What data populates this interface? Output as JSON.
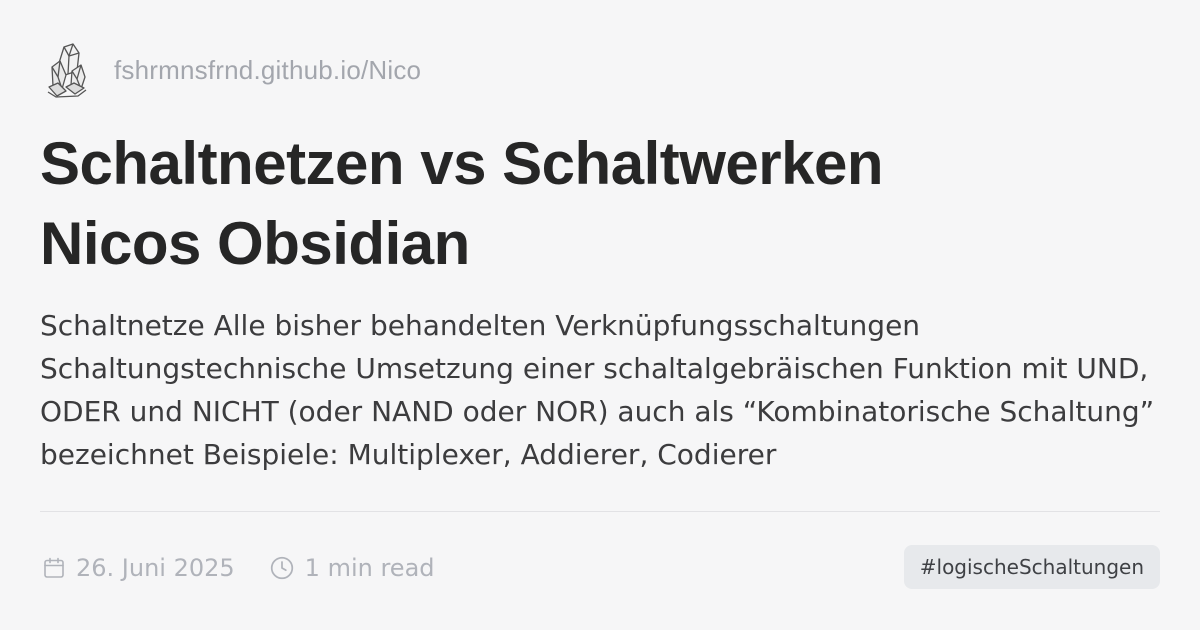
{
  "site": {
    "logo_icon": "crystal-icon",
    "name": "fshrmnsfrnd.github.io/Nico"
  },
  "post": {
    "title_line1": "Schaltnetzen vs Schaltwerken",
    "title_line2": "Nicos Obsidian",
    "excerpt": "Schaltnetze Alle bisher behandelten Verknüpfungsschaltungen Schaltungstechnische Umsetzung einer schaltalgebräischen Funktion mit UND, ODER und NICHT (oder NAND oder NOR) auch als “Kombinatorische Schaltung” bezeichnet Beispiele: Multiplexer, Addierer, Codierer"
  },
  "meta": {
    "date_icon": "calendar-icon",
    "date": "26. Juni 2025",
    "reading_icon": "clock-icon",
    "reading_time": "1 min read"
  },
  "tags": [
    "#logischeSchaltungen"
  ],
  "colors": {
    "background": "#f6f6f7",
    "title": "#262626",
    "muted": "#a3a6ad",
    "tag_background": "#e7e9ec"
  }
}
